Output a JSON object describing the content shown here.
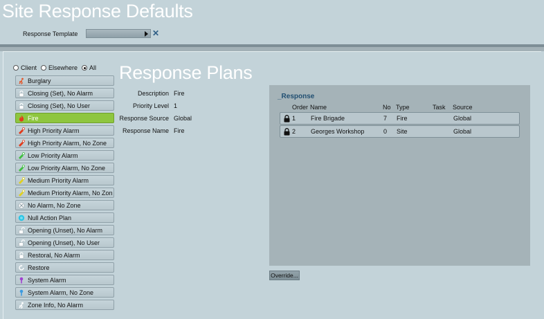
{
  "header": {
    "title": "Site Response Defaults",
    "template_label": "Response Template",
    "template_value": ""
  },
  "section_title": "Response Plans",
  "filter": {
    "options": [
      "Client",
      "Elsewhere",
      "All"
    ],
    "selected": "All"
  },
  "plans": [
    {
      "label": "Burglary",
      "icon": "burglar-icon",
      "color": "#e2572b"
    },
    {
      "label": "Closing (Set), No Alarm",
      "icon": "lock-closed-icon",
      "color": "#ffffff"
    },
    {
      "label": "Closing (Set), No User",
      "icon": "lock-closed-icon",
      "color": "#ffffff"
    },
    {
      "label": "Fire",
      "icon": "fire-icon",
      "color": "#e23b1c"
    },
    {
      "label": "High Priority Alarm",
      "icon": "high-alarm-icon",
      "color": "#e23b1c"
    },
    {
      "label": "High Priority Alarm, No Zone",
      "icon": "high-alarm-icon",
      "color": "#e23b1c"
    },
    {
      "label": "Low Priority Alarm",
      "icon": "low-alarm-icon",
      "color": "#3fbf3f"
    },
    {
      "label": "Low Priority Alarm, No Zone",
      "icon": "low-alarm-icon",
      "color": "#3fbf3f"
    },
    {
      "label": "Medium Priority Alarm",
      "icon": "medium-alarm-icon",
      "color": "#e0d020"
    },
    {
      "label": "Medium Priority Alarm, No Zon",
      "icon": "medium-alarm-icon",
      "color": "#e0d020"
    },
    {
      "label": "No Alarm, No Zone",
      "icon": "no-alarm-icon",
      "color": "#ffffff"
    },
    {
      "label": "Null Action Plan",
      "icon": "null-plan-icon",
      "color": "#29c5e6"
    },
    {
      "label": "Opening (Unset), No Alarm",
      "icon": "lock-open-icon",
      "color": "#ffffff"
    },
    {
      "label": "Opening (Unset), No User",
      "icon": "lock-open-icon",
      "color": "#ffffff"
    },
    {
      "label": "Restoral, No Alarm",
      "icon": "restoral-icon",
      "color": "#ffffff"
    },
    {
      "label": "Restore",
      "icon": "restore-icon",
      "color": "#ffffff"
    },
    {
      "label": "System Alarm",
      "icon": "system-alarm-icon",
      "color": "#a040d0"
    },
    {
      "label": "System Alarm, No Zone",
      "icon": "system-alarm-icon",
      "color": "#3d9be0"
    },
    {
      "label": "Zone Info, No Alarm",
      "icon": "zone-info-icon",
      "color": "#ffffff"
    }
  ],
  "selected_plan": "Fire",
  "details": {
    "description_label": "Description",
    "description": "Fire",
    "priority_label": "Priority Level",
    "priority": "1",
    "source_label": "Response Source",
    "source": "Global",
    "name_label": "Response Name",
    "name": "Fire"
  },
  "response": {
    "title": "_Response",
    "columns": [
      "Order",
      "Name",
      "No",
      "Type",
      "Task",
      "Source"
    ],
    "rows": [
      {
        "order": "1",
        "name": "Fire Brigade",
        "no": "7",
        "type": "Fire",
        "task": "",
        "source": "Global"
      },
      {
        "order": "2",
        "name": "Georges Workshop",
        "no": "0",
        "type": "Site",
        "task": "",
        "source": "Global"
      }
    ]
  },
  "override_label": "Override...",
  "colors": {
    "background": "#c3d3d9",
    "selected": "#8ec63f",
    "panel": "#a5b3b8",
    "accent": "#214f72"
  }
}
